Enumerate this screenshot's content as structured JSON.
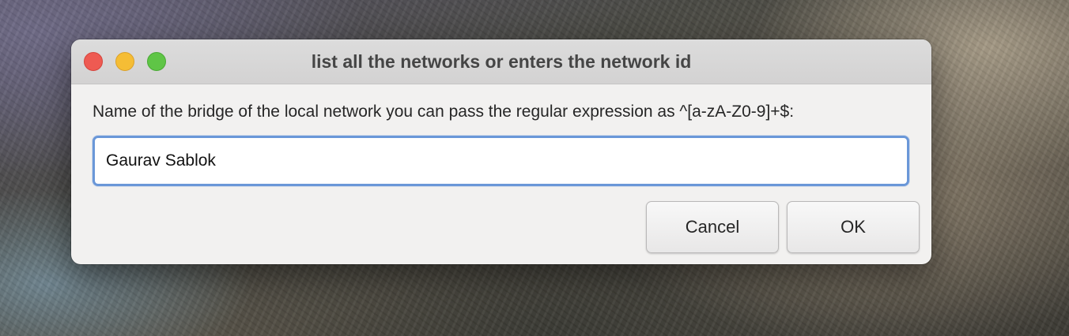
{
  "window": {
    "title": "list all the networks or enters the network id",
    "controls": {
      "close": "close",
      "minimize": "minimize",
      "zoom": "zoom"
    }
  },
  "form": {
    "prompt": "Name of the bridge of the local network you can pass the regular expression as ^[a-zA-Z0-9]+$:",
    "name_value": "Gaurav Sablok",
    "name_placeholder": ""
  },
  "buttons": {
    "cancel_label": "Cancel",
    "ok_label": "OK"
  },
  "colors": {
    "close": "#ee5a52",
    "minimize": "#f5bd35",
    "zoom": "#5fc546",
    "focus_ring": "#6a97d8",
    "dialog_bg": "#f2f1f0"
  }
}
